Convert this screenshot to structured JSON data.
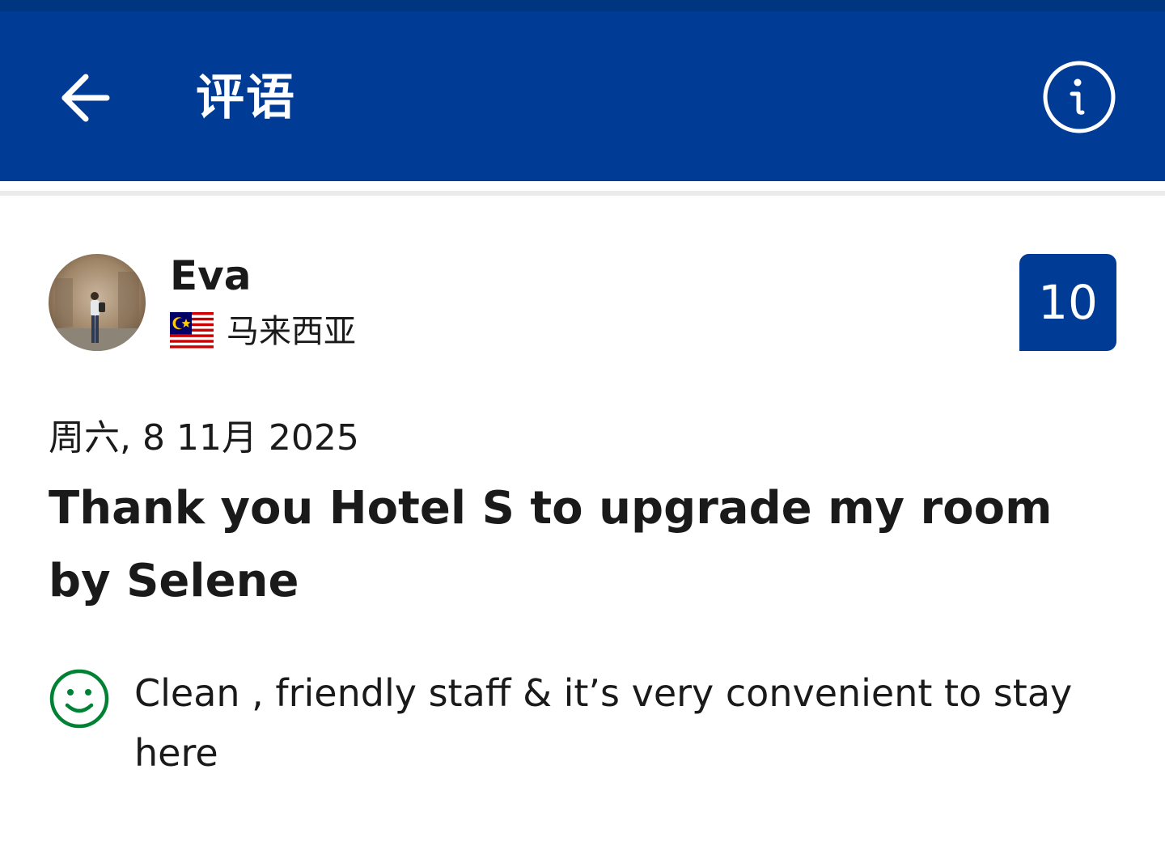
{
  "header": {
    "back_icon": "arrow-left-icon",
    "title": "评语",
    "info_icon": "info-circle-icon",
    "background_color": "#003b95"
  },
  "review": {
    "user": {
      "name": "Eva",
      "country": "马来西亚",
      "flag_icon": "malaysia-flag-icon"
    },
    "score": "10",
    "score_color": "#003b95",
    "date": "周六, 8 11月 2025",
    "title": "Thank you Hotel S to upgrade my room by Selene",
    "positive": {
      "icon": "smile-icon",
      "icon_color": "#008234",
      "text": "Clean , friendly staff & it’s very convenient to stay here"
    }
  }
}
